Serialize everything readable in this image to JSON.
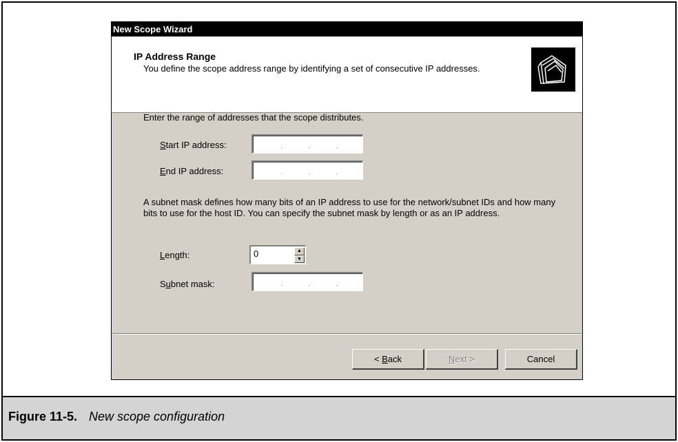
{
  "window": {
    "title": "New Scope Wizard"
  },
  "header": {
    "title": "IP Address Range",
    "subtitle": "You define the scope address range by identifying a set of consecutive IP addresses.",
    "icon": "folders-icon"
  },
  "form": {
    "prompt": "Enter the range of addresses that the scope distributes.",
    "start_ip": {
      "label_pre": "",
      "label_ul": "S",
      "label_post": "tart IP address:",
      "value": ""
    },
    "end_ip": {
      "label_pre": "",
      "label_ul": "E",
      "label_post": "nd IP address:",
      "value": ""
    },
    "subnet_desc": "A subnet mask defines how many bits of an IP address to use for the network/subnet IDs and how many bits to use for the host ID. You can specify the subnet mask by length or as an IP address.",
    "length": {
      "label_pre": "",
      "label_ul": "L",
      "label_post": "ength:",
      "value": "0"
    },
    "subnet_mask": {
      "label_pre": "S",
      "label_ul": "u",
      "label_post": "bnet mask:",
      "value": ""
    }
  },
  "buttons": {
    "back": {
      "pre": "< ",
      "ul": "B",
      "post": "ack"
    },
    "next": {
      "pre": "",
      "ul": "N",
      "post": "ext >"
    },
    "cancel": "Cancel"
  },
  "figure": {
    "label": "Figure 11-5.",
    "caption": "New scope configuration"
  }
}
